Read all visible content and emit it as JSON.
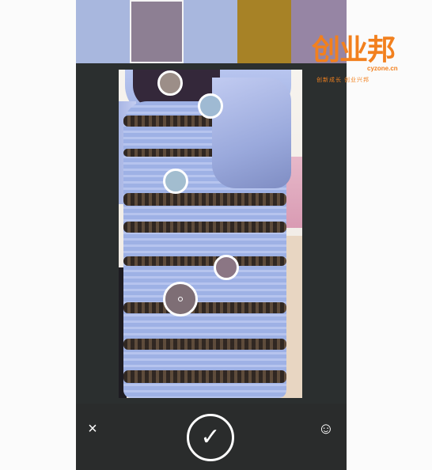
{
  "palette": {
    "swatches": [
      {
        "color": "#a8b7de",
        "selected": false
      },
      {
        "color": "#8d7f93",
        "selected": true
      },
      {
        "color": "#a8b7de",
        "selected": false
      },
      {
        "color": "#a78226",
        "selected": false
      },
      {
        "color": "#9685a4",
        "selected": false
      }
    ]
  },
  "markers": [
    {
      "fill": "#9c8e88"
    },
    {
      "fill": "#9fbad3"
    },
    {
      "fill": "#a2bdcf"
    },
    {
      "fill": "#8b7684"
    },
    {
      "fill": "#7e6e75",
      "active": true
    }
  ],
  "toolbar": {
    "close_icon": "×",
    "confirm_icon": "✓",
    "emoji_icon": "☺"
  },
  "watermark": {
    "logo": "创业邦",
    "domain": "cyzone.cn",
    "slogan": "创新成长  创业兴邦"
  }
}
